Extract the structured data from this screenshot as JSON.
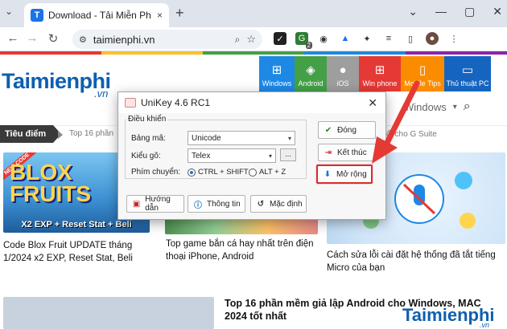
{
  "browser": {
    "tab_title": "Download - Tải Miễn Phí VN - P",
    "tab_favicon": "T",
    "url": "taimienphi.vn",
    "new_tab": "+",
    "close_tab": "×",
    "win_controls": [
      "⌄",
      "—",
      "▢",
      "✕"
    ],
    "ext_badge": "2"
  },
  "site": {
    "logo": "Taimienphi",
    "logo_suffix": ".vn",
    "categories": [
      {
        "label": "Windows",
        "icon": "windows-icon",
        "color": "#1e88e5"
      },
      {
        "label": "Android",
        "icon": "android-icon",
        "color": "#43a047"
      },
      {
        "label": "iOS",
        "icon": "apple-icon",
        "color": "#9e9e9e"
      },
      {
        "label": "Win phone",
        "icon": "winphone-icon",
        "color": "#e53935"
      },
      {
        "label": "Mobile Tips",
        "icon": "mobile-icon",
        "color": "#fb8c00"
      },
      {
        "label": "Thủ thuật PC",
        "icon": "pc-icon",
        "color": "#1565c0"
      }
    ],
    "search_text": "Windows",
    "tieudiem_label": "Tiêu điểm",
    "tieudiem_text1": "Top 16 phần",
    "tieudiem_text2": "ối cho G Suite",
    "articles": [
      {
        "title": "Code Blox Fruit UPDATE tháng 1/2024 x2 EXP, Reset Stat, Beli",
        "thumb_caption": "X2 EXP + Reset Stat + Beli",
        "thumb_text": "BLOX\nFRUITS",
        "thumb_badge": "NEW CODE"
      },
      {
        "title": "Top game bắn cá hay nhất trên điện thoại iPhone, Android"
      },
      {
        "title": "Cách sửa lỗi cài đặt hệ thống đã tắt tiếng Micro của bạn"
      },
      {
        "title": "Top 16 phần mềm giả lập Android cho Windows, MAC 2024 tốt nhất"
      }
    ],
    "watermark": "Taimienphi",
    "watermark_suffix": ".vn"
  },
  "dialog": {
    "title": "UniKey 4.6 RC1",
    "close": "✕",
    "group_label": "Điều khiển",
    "charset_label": "Bảng mã:",
    "charset_value": "Unicode",
    "typing_label": "Kiểu gõ:",
    "typing_value": "Telex",
    "typing_more": "...",
    "switch_label": "Phím chuyển:",
    "switch_options": [
      {
        "label": "CTRL + SHIFT",
        "selected": true
      },
      {
        "label": "ALT + Z",
        "selected": false
      }
    ],
    "buttons": {
      "close": "Đóng",
      "exit": "Kết thúc",
      "expand": "Mở rộng",
      "help": "Hướng dẫn",
      "info": "Thông tin",
      "default": "Mặc định"
    }
  },
  "colors": {
    "highlight": "#d32f2f",
    "brand_blue": "#0d5fb0"
  }
}
